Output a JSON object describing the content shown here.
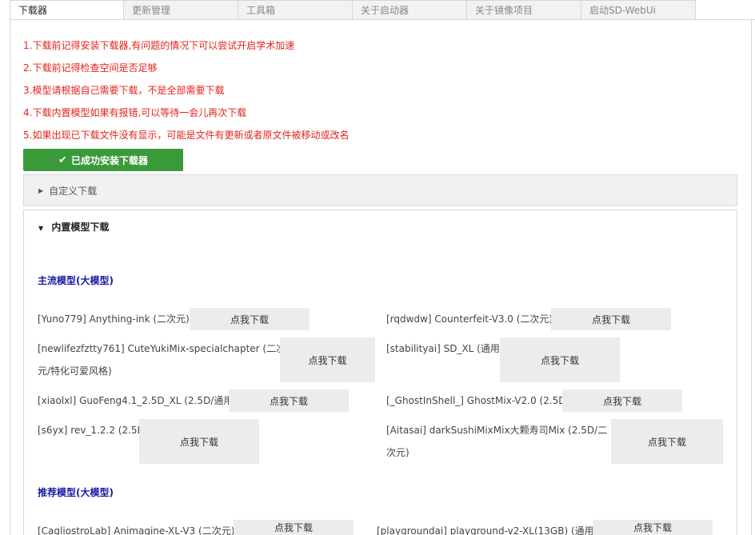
{
  "tabs": [
    "下载器",
    "更新管理",
    "工具箱",
    "关于启动器",
    "关于镜像项目",
    "启动SD-WebUi"
  ],
  "notes": [
    "1.下载前记得安装下载器,有问题的情况下可以尝试开启学术加速",
    "2.下载前记得检查空间是否足够",
    "3.模型请根据自己需要下载，不是全部需要下载",
    "4.下载内置模型如果有报错,可以等待一会儿再次下载",
    "5.如果出现已下载文件没有显示，可能是文件有更新或者原文件被移动或改名"
  ],
  "success_button": "已成功安装下载器",
  "custom_download": "自定义下载",
  "builtin_download": "内置模型下载",
  "sections": {
    "mainstream": "主流模型(大模型)",
    "recommended": "推荐模型(大模型)"
  },
  "download_label": "点我下载",
  "models": [
    {
      "name": "[Yuno779] Anything-ink (二次元)"
    },
    {
      "name": "[rqdwdw] Counterfeit-V3.0 (二次元)"
    },
    {
      "name_line1": "[newlifezfztty761] CuteYukiMix-specialchapter (二次",
      "name_line2": "元/特化可爱风格)"
    },
    {
      "name": "[stabilityai] SD_XL (通用)"
    },
    {
      "name": "[xiaolxl] GuoFeng4.1_2.5D_XL (2.5D/通用)"
    },
    {
      "name": "[_GhostInShell_] GhostMix-V2.0 (2.5D)"
    },
    {
      "name": "[s6yx] rev_1.2.2 (2.5D)"
    },
    {
      "name_line1": "[Aitasai] darkSushiMixMix大颗寿司Mix (2.5D/二",
      "name_line2": "次元)"
    },
    {
      "name": "[CagliostroLab] Animagine-XL-V3 (二次元)"
    },
    {
      "name": "[playgroundai] playground-v2-XL(13GB) (通用)"
    }
  ],
  "colors": {
    "note_red": "#e3231b",
    "success_green": "#3a9a3a",
    "section_blue": "#1a1aa6",
    "button_gray": "#ececec"
  }
}
